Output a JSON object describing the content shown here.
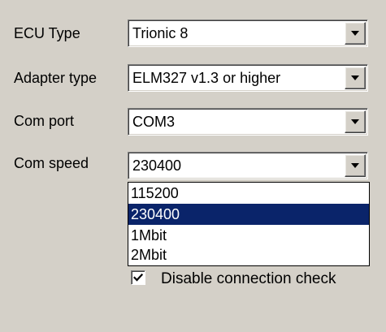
{
  "form": {
    "ecu_type": {
      "label": "ECU Type",
      "value": "Trionic 8",
      "dropdown_icon": "chevron-down-icon"
    },
    "adapter_type": {
      "label": "Adapter type",
      "value": "ELM327 v1.3 or higher",
      "dropdown_icon": "chevron-down-icon"
    },
    "com_port": {
      "label": "Com port",
      "value": "COM3",
      "dropdown_icon": "chevron-down-icon"
    },
    "com_speed": {
      "label": "Com speed",
      "value": "230400",
      "dropdown_icon": "chevron-down-icon",
      "options": [
        "115200",
        "230400",
        "1Mbit",
        "2Mbit"
      ],
      "highlighted_option": "230400"
    },
    "disable_connection_check": {
      "label": "Disable connection check",
      "checked": true,
      "icon": "checkmark-icon"
    }
  },
  "colors": {
    "window_bg": "#d4d0c8",
    "selection_bg": "#0a246a",
    "selection_text": "#ffffff"
  }
}
